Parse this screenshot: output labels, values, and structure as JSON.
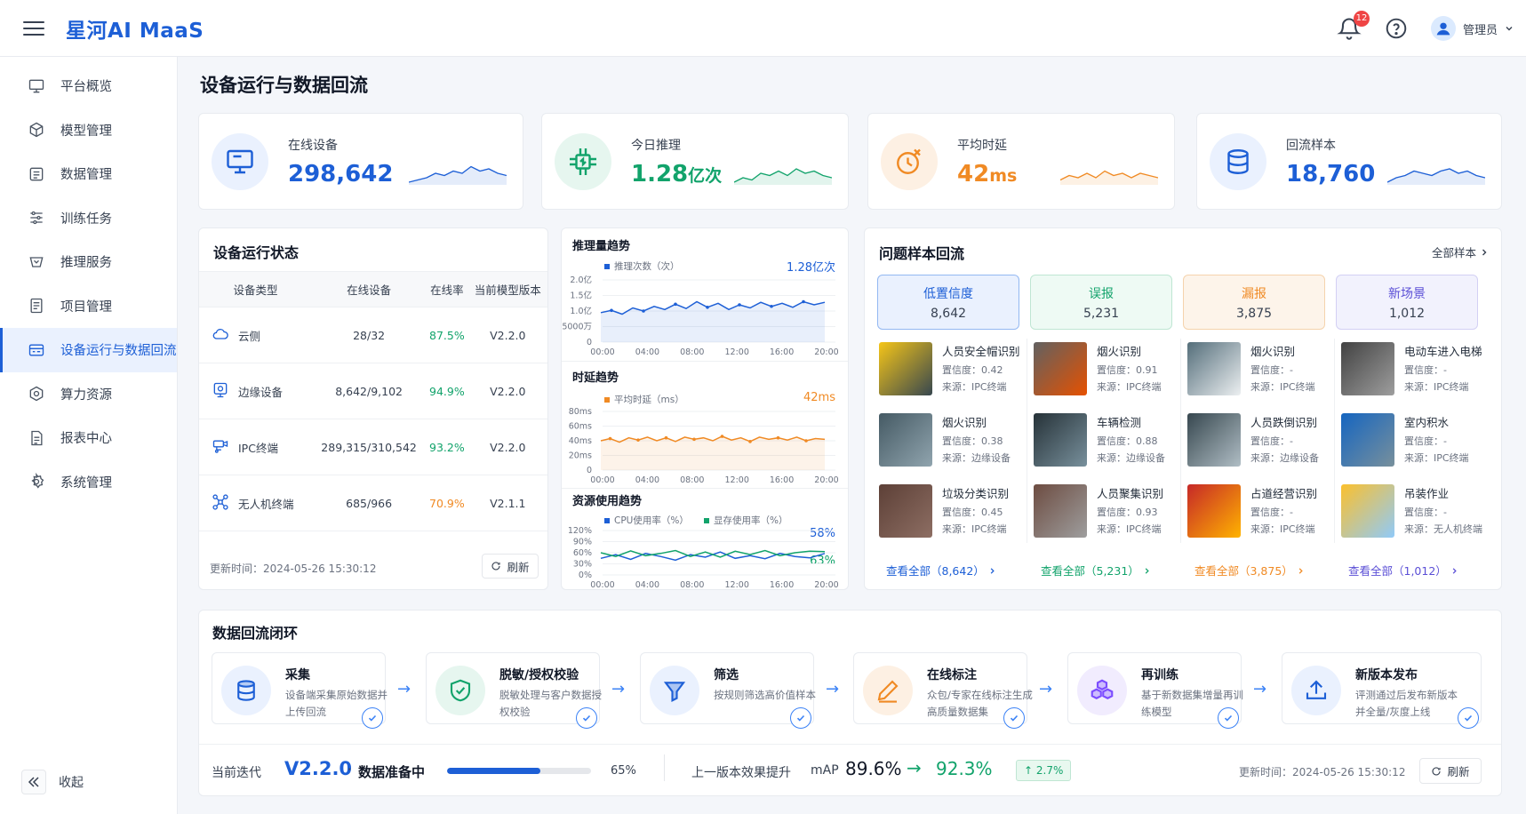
{
  "app": {
    "brand": "星河AI MaaS",
    "notifications": "12",
    "user": "管理员"
  },
  "sidebar": {
    "items": [
      {
        "label": "平台概览",
        "icon": "monitor-icon"
      },
      {
        "label": "模型管理",
        "icon": "cube-icon"
      },
      {
        "label": "数据管理",
        "icon": "database-icon"
      },
      {
        "label": "训练任务",
        "icon": "sliders-icon"
      },
      {
        "label": "推理服务",
        "icon": "inference-icon"
      },
      {
        "label": "项目管理",
        "icon": "document-icon"
      },
      {
        "label": "设备运行与数据回流",
        "icon": "device-icon",
        "active": true
      },
      {
        "label": "算力资源",
        "icon": "hexagon-icon"
      },
      {
        "label": "报表中心",
        "icon": "report-icon"
      },
      {
        "label": "系统管理",
        "icon": "gear-icon"
      }
    ],
    "collapse": "收起"
  },
  "page": {
    "title": "设备运行与数据回流"
  },
  "kpis": [
    {
      "label": "在线设备",
      "value": "298,642",
      "unit": "",
      "color": "#1d5fd6",
      "bg": "#eaf1fe"
    },
    {
      "label": "今日推理",
      "value": "1.28",
      "unit": "亿次",
      "color": "#12a36b",
      "bg": "#e6f6ef"
    },
    {
      "label": "平均时延",
      "value": "42",
      "unit": "ms",
      "color": "#f08a24",
      "bg": "#fdf0e3"
    },
    {
      "label": "回流样本",
      "value": "18,760",
      "unit": "",
      "color": "#1d5fd6",
      "bg": "#eaf1fe"
    }
  ],
  "device_status": {
    "title": "设备运行状态",
    "headers": [
      "设备类型",
      "在线设备",
      "在线率",
      "当前模型版本"
    ],
    "rows": [
      {
        "type": "云侧",
        "online": "28/32",
        "rate": "87.5%",
        "rate_color": "#12a36b",
        "version": "V2.2.0",
        "icon": "cloud-icon"
      },
      {
        "type": "边缘设备",
        "online": "8,642/9,102",
        "rate": "94.9%",
        "rate_color": "#12a36b",
        "version": "V2.2.0",
        "icon": "edge-device-icon"
      },
      {
        "type": "IPC终端",
        "online": "289,315/310,542",
        "rate": "93.2%",
        "rate_color": "#12a36b",
        "version": "V2.2.0",
        "icon": "camera-icon"
      },
      {
        "type": "无人机终端",
        "online": "685/966",
        "rate": "70.9%",
        "rate_color": "#f08a24",
        "version": "V2.1.1",
        "icon": "drone-icon"
      }
    ],
    "updated": "更新时间：2024-05-26 15:30:12",
    "refresh": "刷新"
  },
  "charts_panel": {
    "inference": {
      "title": "推理量趋势",
      "legend": "推理次数（次）",
      "current": "1.28亿次"
    },
    "latency": {
      "title": "时延趋势",
      "legend": "平均时延（ms）",
      "current": "42ms"
    },
    "resource": {
      "title": "资源使用趋势",
      "legend_cpu": "CPU使用率（%）",
      "legend_gpu": "显存使用率（%）",
      "cpu_current": "58%",
      "gpu_current": "63%"
    }
  },
  "chart_data": [
    {
      "type": "line",
      "title": "推理量趋势",
      "x": [
        "00:00",
        "04:00",
        "08:00",
        "12:00",
        "16:00",
        "20:00"
      ],
      "y_ticks": [
        "2.0亿",
        "1.5亿",
        "1.0亿",
        "5000万",
        "0"
      ],
      "ylim": [
        0,
        2.0
      ],
      "series": [
        {
          "name": "推理次数（次）",
          "values": [
            0.95,
            1.02,
            0.9,
            1.1,
            1.0,
            1.15,
            1.05,
            1.22,
            1.08,
            1.3,
            1.12,
            1.25,
            1.05,
            1.2,
            1.1,
            1.28,
            1.15,
            1.25,
            1.12,
            1.3,
            1.2,
            1.28
          ]
        }
      ]
    },
    {
      "type": "line",
      "title": "时延趋势",
      "x": [
        "00:00",
        "04:00",
        "08:00",
        "12:00",
        "16:00",
        "20:00"
      ],
      "y_ticks": [
        "80ms",
        "60ms",
        "40ms",
        "20ms",
        "0"
      ],
      "ylim": [
        0,
        80
      ],
      "series": [
        {
          "name": "平均时延（ms）",
          "values": [
            40,
            43,
            38,
            44,
            41,
            45,
            40,
            44,
            39,
            45,
            42,
            44,
            40,
            46,
            41,
            44,
            39,
            45,
            42,
            44,
            41,
            45,
            40,
            43,
            42
          ]
        }
      ]
    },
    {
      "type": "line",
      "title": "资源使用趋势",
      "x": [
        "00:00",
        "04:00",
        "08:00",
        "12:00",
        "16:00",
        "20:00"
      ],
      "y_ticks": [
        "120%",
        "90%",
        "60%",
        "30%",
        "0%"
      ],
      "ylim": [
        0,
        120
      ],
      "series": [
        {
          "name": "CPU使用率（%）",
          "values": [
            45,
            55,
            42,
            58,
            50,
            40,
            55,
            48,
            62,
            45,
            52,
            44,
            58,
            50,
            46,
            58
          ]
        },
        {
          "name": "显存使用率（%）",
          "values": [
            60,
            50,
            65,
            52,
            58,
            66,
            50,
            62,
            48,
            64,
            55,
            66,
            52,
            60,
            64,
            63
          ]
        }
      ]
    }
  ],
  "samples": {
    "title": "问题样本回流",
    "all_link": "全部样本",
    "categories": [
      {
        "name": "低置信度",
        "count": "8,642",
        "color": "#1d5fd6",
        "bg": "#eaf1fe",
        "border": "#93b8f2",
        "view_all": "查看全部（8,642）"
      },
      {
        "name": "误报",
        "count": "5,231",
        "color": "#12a36b",
        "bg": "#eefaf4",
        "border": "#bfe6d3",
        "view_all": "查看全部（5,231）"
      },
      {
        "name": "漏报",
        "count": "3,875",
        "color": "#f08a24",
        "bg": "#fdf4ea",
        "border": "#f5d3ad",
        "view_all": "查看全部（3,875）"
      },
      {
        "name": "新场景",
        "count": "1,012",
        "color": "#5b4fd6",
        "bg": "#f2f2fd",
        "border": "#d3d0f4",
        "view_all": "查看全部（1,012）"
      }
    ],
    "columns": [
      [
        {
          "name": "人员安全帽识别",
          "conf": "置信度：0.42",
          "src": "来源：IPC终端",
          "tone": [
            "#f5c518",
            "#37474f"
          ]
        },
        {
          "name": "烟火识别",
          "conf": "置信度：0.38",
          "src": "来源：边缘设备",
          "tone": [
            "#455a64",
            "#90a4ae"
          ]
        },
        {
          "name": "垃圾分类识别",
          "conf": "置信度：0.45",
          "src": "来源：IPC终端",
          "tone": [
            "#5d4037",
            "#8d6e63"
          ]
        }
      ],
      [
        {
          "name": "烟火识别",
          "conf": "置信度：0.91",
          "src": "来源：IPC终端",
          "tone": [
            "#616161",
            "#e65100"
          ]
        },
        {
          "name": "车辆检测",
          "conf": "置信度：0.88",
          "src": "来源：边缘设备",
          "tone": [
            "#263238",
            "#78909c"
          ]
        },
        {
          "name": "人员聚集识别",
          "conf": "置信度：0.93",
          "src": "来源：IPC终端",
          "tone": [
            "#6d4c41",
            "#9e9e9e"
          ]
        }
      ],
      [
        {
          "name": "烟火识别",
          "conf": "置信度：-",
          "src": "来源：IPC终端",
          "tone": [
            "#546e7a",
            "#eceff1"
          ]
        },
        {
          "name": "人员跌倒识别",
          "conf": "置信度：-",
          "src": "来源：边缘设备",
          "tone": [
            "#37474f",
            "#b0bec5"
          ]
        },
        {
          "name": "占道经营识别",
          "conf": "置信度：-",
          "src": "来源：IPC终端",
          "tone": [
            "#c62828",
            "#ffb300"
          ]
        }
      ],
      [
        {
          "name": "电动车进入电梯",
          "conf": "置信度：-",
          "src": "来源：IPC终端",
          "tone": [
            "#424242",
            "#9e9e9e"
          ]
        },
        {
          "name": "室内积水",
          "conf": "置信度：-",
          "src": "来源：IPC终端",
          "tone": [
            "#1565c0",
            "#78909c"
          ]
        },
        {
          "name": "吊装作业",
          "conf": "置信度：-",
          "src": "来源：无人机终端",
          "tone": [
            "#fbc02d",
            "#90caf9"
          ]
        }
      ]
    ]
  },
  "loop": {
    "title": "数据回流闭环",
    "steps": [
      {
        "title": "采集",
        "desc": "设备端采集原始数据并上传回流",
        "icon": "database-icon",
        "color": "#1d5fd6",
        "bg": "#eaf1fe"
      },
      {
        "title": "脱敏/授权校验",
        "desc": "脱敏处理与客户数据授权校验",
        "icon": "shield-check-icon",
        "color": "#12a36b",
        "bg": "#e6f6ef"
      },
      {
        "title": "筛选",
        "desc": "按规则筛选高价值样本",
        "icon": "filter-icon",
        "color": "#1d5fd6",
        "bg": "#eaf1fe"
      },
      {
        "title": "在线标注",
        "desc": "众包/专家在线标注生成高质量数据集",
        "icon": "pencil-icon",
        "color": "#f08a24",
        "bg": "#fdf0e3"
      },
      {
        "title": "再训练",
        "desc": "基于新数据集增量再训练模型",
        "icon": "cubes-icon",
        "color": "#7c4dff",
        "bg": "#f1ecfe"
      },
      {
        "title": "新版本发布",
        "desc": "评测通过后发布新版本并全量/灰度上线",
        "icon": "upload-icon",
        "color": "#1d5fd6",
        "bg": "#eaf1fe"
      }
    ],
    "iteration_label": "当前迭代",
    "version": "V2.2.0",
    "dot": "·",
    "status": "数据准备中",
    "progress": 0.65,
    "progress_text": "65%",
    "improve_label": "上一版本效果提升",
    "map_label": "mAP",
    "map_old": "89.6%",
    "map_new": "92.3%",
    "delta": "2.7%",
    "updated": "更新时间：2024-05-26 15:30:12",
    "refresh": "刷新"
  }
}
